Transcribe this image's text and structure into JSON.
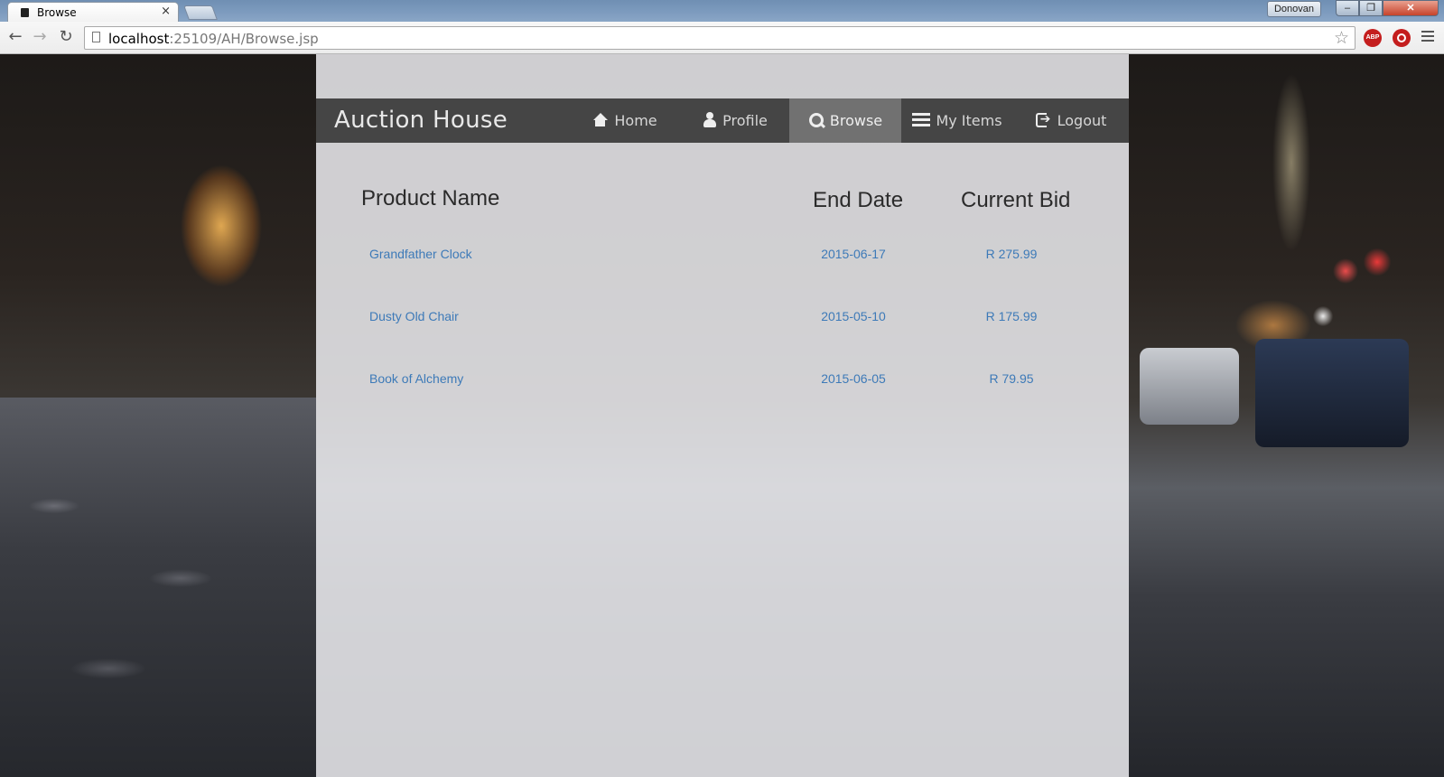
{
  "browser": {
    "tab_title": "Browse",
    "tab_close": "×",
    "user_name": "Donovan",
    "url_host": "localhost",
    "url_rest": ":25109/AH/Browse.jsp",
    "extension_abp_label": "ABP",
    "icons": [
      "back-arrow-icon",
      "forward-arrow-icon",
      "reload-icon",
      "page-icon",
      "star-icon",
      "adblock-icon",
      "power-icon",
      "menu-icon"
    ]
  },
  "navbar": {
    "brand": "Auction House",
    "items": [
      {
        "label": "Home",
        "icon": "home-icon"
      },
      {
        "label": "Profile",
        "icon": "user-icon"
      },
      {
        "label": "Browse",
        "icon": "search-icon",
        "active": true
      },
      {
        "label": "My Items",
        "icon": "list-icon"
      },
      {
        "label": "Logout",
        "icon": "logout-icon"
      }
    ]
  },
  "table": {
    "headers": [
      "Product Name",
      "End Date",
      "Current Bid"
    ],
    "rows": [
      {
        "name": "Grandfather Clock",
        "end_date": "2015-06-17",
        "bid": "R 275.99"
      },
      {
        "name": "Dusty Old Chair",
        "end_date": "2015-05-10",
        "bid": "R 175.99"
      },
      {
        "name": "Book of Alchemy",
        "end_date": "2015-06-05",
        "bid": "R 79.95"
      }
    ]
  },
  "colors": {
    "link": "#3d7ab8",
    "navbar_bg": "#3a3a3a",
    "active_nav_bg": "#969696"
  }
}
